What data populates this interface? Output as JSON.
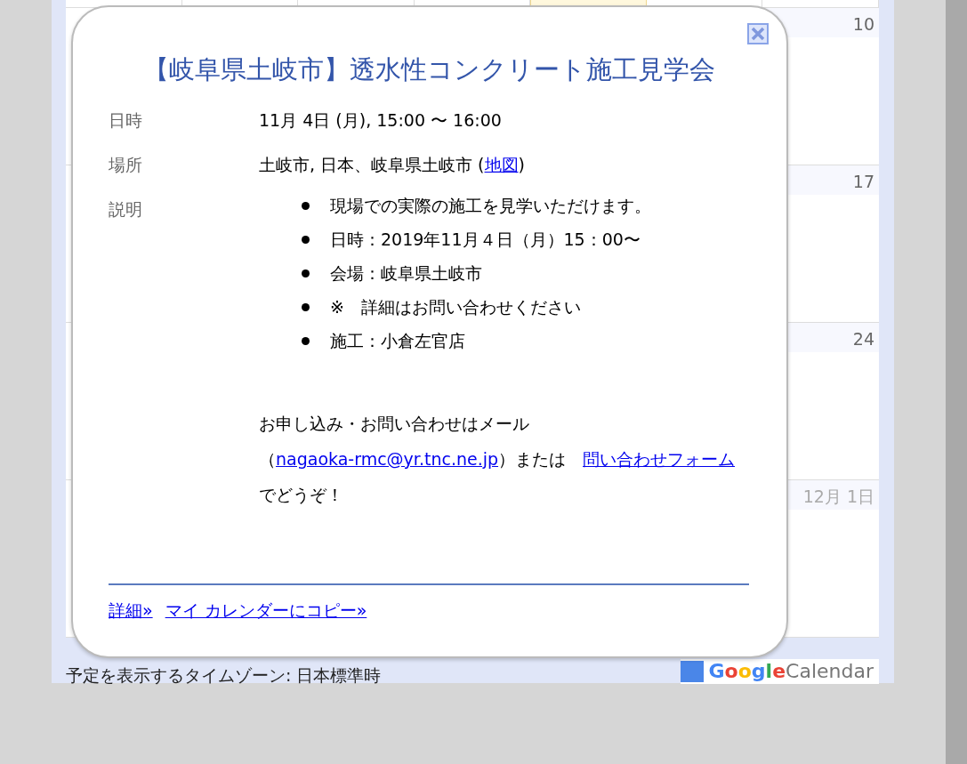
{
  "calendar": {
    "partial_week": {
      "days": [
        {
          "today": false
        },
        {
          "today": false
        },
        {
          "today": false
        },
        {
          "today": false
        },
        {
          "today": true
        },
        {
          "today": false
        },
        {
          "today": false
        }
      ]
    },
    "weeks": [
      {
        "last_day_label": "10",
        "other_month": false
      },
      {
        "last_day_label": "17",
        "other_month": false
      },
      {
        "last_day_label": "24",
        "other_month": false
      },
      {
        "last_day_label": "12月 1日",
        "other_month": true
      }
    ],
    "timezone_note": "予定を表示するタイムゾーン: 日本標準時",
    "logo": {
      "brand": "Google",
      "product": "Calendar"
    }
  },
  "event_popup": {
    "title": "【岐阜県土岐市】透水性コンクリート施工見学会",
    "fields": [
      {
        "label": "日時",
        "segments": [
          {
            "kind": "text",
            "text": "11月 4日 (月), 15:00 〜 16:00"
          }
        ]
      },
      {
        "label": "場所",
        "segments": [
          {
            "kind": "text",
            "text": "土岐市, 日本、岐阜県土岐市 ("
          },
          {
            "kind": "link",
            "text": "地図"
          },
          {
            "kind": "text",
            "text": ")"
          }
        ]
      },
      {
        "label": "説明",
        "bullets": [
          "現場での実際の施工を見学いただけます。",
          "日時：2019年11月４日（月）15：00〜",
          "会場：岐阜県土岐市",
          "※　詳細はお問い合わせください",
          "施工：小倉左官店"
        ],
        "paragraph": [
          {
            "kind": "text",
            "text": "お申し込み・お問い合わせはメール（"
          },
          {
            "kind": "link",
            "text": "nagaoka-rmc@yr.tnc.ne.jp"
          },
          {
            "kind": "text",
            "text": "）または　"
          },
          {
            "kind": "link",
            "text": "問い合わせフォーム"
          },
          {
            "kind": "text",
            "text": "でどうぞ！"
          }
        ]
      }
    ],
    "footer_links": [
      "詳細»",
      "マイ カレンダーにコピー»"
    ]
  }
}
